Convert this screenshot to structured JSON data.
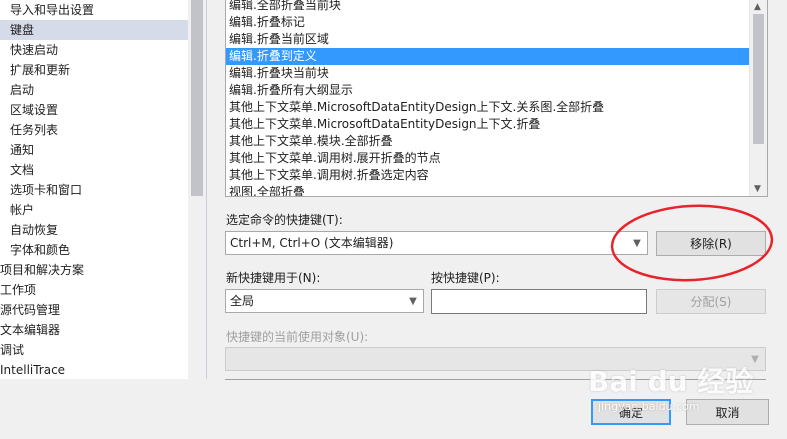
{
  "tree": {
    "items": [
      {
        "label": "导入和导出设置",
        "selected": false
      },
      {
        "label": "键盘",
        "selected": true
      },
      {
        "label": "快速启动",
        "selected": false
      },
      {
        "label": "扩展和更新",
        "selected": false
      },
      {
        "label": "启动",
        "selected": false
      },
      {
        "label": "区域设置",
        "selected": false
      },
      {
        "label": "任务列表",
        "selected": false
      },
      {
        "label": "通知",
        "selected": false
      },
      {
        "label": "文档",
        "selected": false
      },
      {
        "label": "选项卡和窗口",
        "selected": false
      },
      {
        "label": "帐户",
        "selected": false
      },
      {
        "label": "自动恢复",
        "selected": false
      },
      {
        "label": "字体和颜色",
        "selected": false
      },
      {
        "label": "项目和解决方案",
        "selected": false
      },
      {
        "label": "工作项",
        "selected": false
      },
      {
        "label": "源代码管理",
        "selected": false
      },
      {
        "label": "文本编辑器",
        "selected": false
      },
      {
        "label": "调试",
        "selected": false
      },
      {
        "label": "IntelliTrace",
        "selected": false
      }
    ]
  },
  "commands": {
    "items": [
      {
        "label": "编辑.全部折叠当前块",
        "selected": false
      },
      {
        "label": "编辑.折叠标记",
        "selected": false
      },
      {
        "label": "编辑.折叠当前区域",
        "selected": false
      },
      {
        "label": "编辑.折叠到定义",
        "selected": true
      },
      {
        "label": "编辑.折叠块当前块",
        "selected": false
      },
      {
        "label": "编辑.折叠所有大纲显示",
        "selected": false
      },
      {
        "label": "其他上下文菜单.MicrosoftDataEntityDesign上下文.关系图.全部折叠",
        "selected": false
      },
      {
        "label": "其他上下文菜单.MicrosoftDataEntityDesign上下文.折叠",
        "selected": false
      },
      {
        "label": "其他上下文菜单.模块.全部折叠",
        "selected": false
      },
      {
        "label": "其他上下文菜单.调用树.展开折叠的节点",
        "selected": false
      },
      {
        "label": "其他上下文菜单.调用树.折叠选定内容",
        "selected": false
      },
      {
        "label": "视图.全部折叠",
        "selected": false
      }
    ]
  },
  "shortcuts_for_command": {
    "label": "选定命令的快捷键(T):",
    "selected_value": "Ctrl+M, Ctrl+O (文本编辑器)",
    "remove_label": "移除(R)"
  },
  "new_shortcut_scope": {
    "label": "新快捷键用于(N):",
    "value": "全局"
  },
  "press_shortcut": {
    "label": "按快捷键(P):",
    "value": "",
    "assign_label": "分配(S)"
  },
  "currently_used_by": {
    "label": "快捷键的当前使用对象(U):",
    "value": ""
  },
  "footer": {
    "ok_label": "确定",
    "cancel_label": "取消"
  },
  "watermark": {
    "brand": "Bai du 经验",
    "url": "jingyan.baidu.com"
  },
  "colors": {
    "selection": "#3399ff",
    "tree_selection": "#d6dbe9",
    "annotation": "#e8232b",
    "background": "#f0f0f0"
  }
}
